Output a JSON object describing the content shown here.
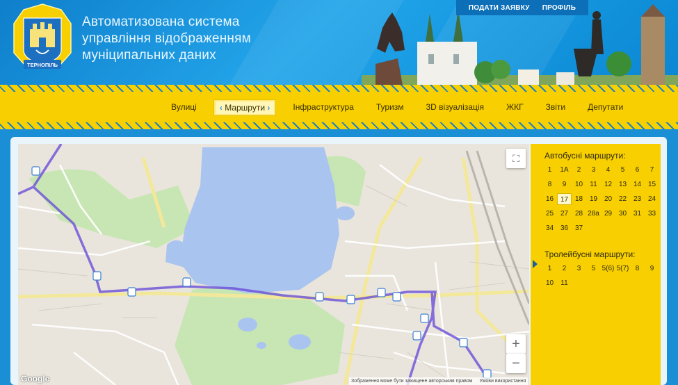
{
  "header": {
    "title_lines": [
      "Автоматизована система",
      "управління відображенням",
      "муніципальних даних"
    ],
    "logo_text": "ТЕРНОПІЛЬ",
    "top_links": [
      "ПОДАТИ ЗАЯВКУ",
      "ПРОФІЛЬ"
    ]
  },
  "nav": {
    "items": [
      "Вулиці",
      "Маршрути",
      "Інфраструктура",
      "Туризм",
      "3D візуалізація",
      "ЖКГ",
      "Звіти",
      "Депутати"
    ],
    "active": "Маршрути"
  },
  "sidebar": {
    "bus_title": "Автобусні маршрути:",
    "bus_routes": [
      "1",
      "1А",
      "2",
      "3",
      "4",
      "5",
      "6",
      "7",
      "8",
      "9",
      "10",
      "11",
      "12",
      "13",
      "14",
      "15",
      "16",
      "17",
      "18",
      "19",
      "20",
      "22",
      "23",
      "24",
      "25",
      "27",
      "28",
      "28а",
      "29",
      "30",
      "31",
      "33",
      "34",
      "36",
      "37"
    ],
    "selected_route": "17",
    "trolley_title": "Тролейбусні маршрути:",
    "trolley_routes": [
      "1",
      "2",
      "3",
      "5",
      "5(6)",
      "5(7)",
      "8",
      "9",
      "10",
      "11"
    ]
  },
  "map": {
    "attribution": "Зображення може бути захищене авторським правом",
    "terms": "Умови використання",
    "google": "Google",
    "zoom_in": "+",
    "zoom_out": "−",
    "route_color": "#6a4fd8",
    "water_color": "#a9c3f0",
    "park_color": "#c6e3b0"
  },
  "colors": {
    "accent": "#f8cf00",
    "header_blue": "#1598e0"
  }
}
